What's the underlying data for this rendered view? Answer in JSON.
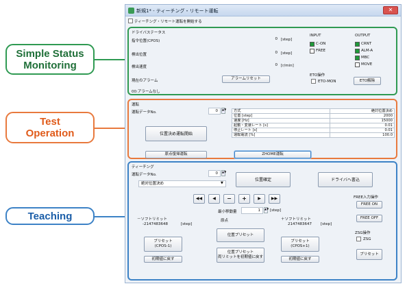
{
  "callouts": {
    "status": "Simple Status\nMonitoring",
    "test": "Test\nOperation",
    "teaching": "Teaching"
  },
  "window": {
    "title": "新規1* - ティーチング・リモート運転",
    "close": "✕",
    "start_checkbox_label": "ティーチング・リモート運転を開始する"
  },
  "status": {
    "group_label": "ドライバステータス",
    "cmd_pos_label": "指令位置(CPOS)",
    "cmd_pos_value": "0",
    "cmd_pos_unit": "[step]",
    "det_pos_label": "検出位置",
    "det_pos_value": "0",
    "det_pos_unit": "[step]",
    "det_speed_label": "検出速度",
    "det_speed_value": "0",
    "det_speed_unit": "[r/min]",
    "alarm_label": "現在のアラーム",
    "alarm_reset": "アラームリセット",
    "alarm_text": "00:アラームなし",
    "input_header": "INPUT",
    "output_header": "OUTPUT",
    "inputs": [
      "C-ON",
      "FREE"
    ],
    "outputs": [
      "CRNT",
      "ALM-A",
      "MBC",
      "MOVE"
    ],
    "eto_label": "ETO操作",
    "eto_mon": "ETO-MON",
    "eto_release": "ETO解除"
  },
  "operation": {
    "group_label": "運転",
    "data_no_label": "運転データNo.",
    "data_no_value": "0",
    "start_button": "位置決め運転開始",
    "return_button": "原点復帰運転",
    "zhome_button": "ZHOME運転",
    "table": [
      [
        "方式",
        "絶対位置決め"
      ],
      [
        "位置 [step]",
        "2000"
      ],
      [
        "速度 [Hz]",
        "15000"
      ],
      [
        "起動・変速レート [s]",
        "0.01"
      ],
      [
        "停止レート [s]",
        "0.01"
      ],
      [
        "運転電流 [%]",
        "100.0"
      ]
    ]
  },
  "teaching": {
    "group_label": "ティーチング",
    "data_no_label": "運転データNo.",
    "data_no_value": "0",
    "mode_value": "絶対位置決め",
    "confirm_button": "位置確定",
    "driver_write_button": "ドライバへ書込",
    "min_move_label": "最小移動量",
    "min_move_value": "1",
    "min_move_unit": "[step]",
    "free_label": "FREE入力操作",
    "free_on": "FREE ON",
    "free_off": "FREE OFF",
    "zsg_label": "ZSG操作",
    "zsg_checkbox": "ZSG",
    "preset_button": "プリセット",
    "soft_minus_label": "－ソフトリミット",
    "soft_minus_value": "-2147483648",
    "soft_minus_unit": "[step]",
    "origin_label": "原点",
    "soft_plus_label": "＋ソフトリミット",
    "soft_plus_value": "2147483647",
    "soft_plus_unit": "[step]",
    "preset_minus": "プリセット\n(CPOS-1)",
    "position_preset": "位置プリセット",
    "preset_plus": "プリセット\n(CPOS+1)",
    "initial_minus": "初期値に戻す",
    "both_limits_initial": "位置プリセット\n両リミットを初期値に戻す",
    "initial_plus": "初期値に戻す",
    "jog": [
      "◀◀",
      "◀",
      "−",
      "+",
      "▶",
      "▶▶"
    ]
  },
  "colors": {
    "green": "#2f9a52",
    "orange": "#e8793d",
    "blue": "#3c82c6"
  }
}
